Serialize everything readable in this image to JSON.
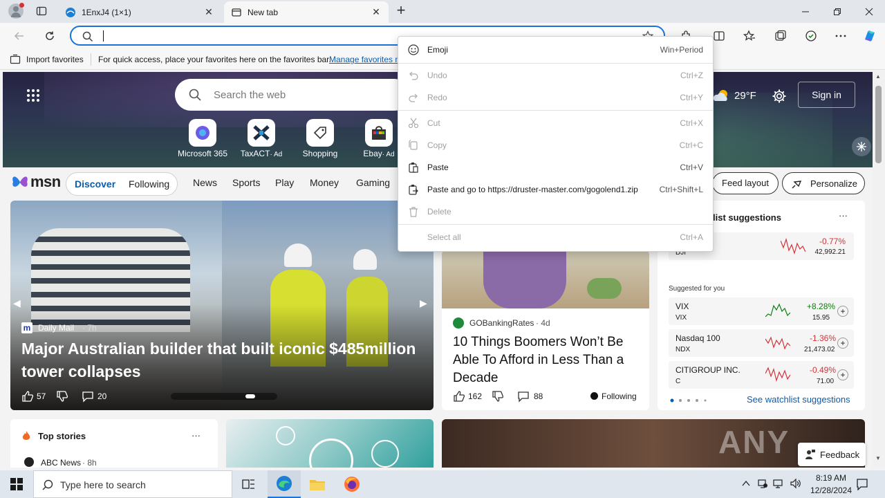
{
  "browser": {
    "tabs": [
      {
        "label": "1EnxJ4 (1×1)",
        "active": false
      },
      {
        "label": "New tab",
        "active": true
      }
    ],
    "new_tab_symbol": "+",
    "address_value": "",
    "favorites_bar": {
      "import_label": "Import favorites",
      "hint": "For quick access, place your favorites here on the favorites bar.",
      "manage_link": "Manage favorites n"
    }
  },
  "hero": {
    "search_placeholder": "Search the web",
    "weather": "29°F",
    "sign_in": "Sign in",
    "quick_links": [
      {
        "label": "Microsoft 365",
        "ad": ""
      },
      {
        "label": "TaxACT",
        "ad": "· Ad"
      },
      {
        "label": "Shopping",
        "ad": ""
      },
      {
        "label": "Ebay",
        "ad": "· Ad"
      }
    ]
  },
  "msn_nav": {
    "logo": "msn",
    "discover": "Discover",
    "following": "Following",
    "items": [
      "News",
      "Sports",
      "Play",
      "Money",
      "Gaming"
    ],
    "feed_layout": "Feed layout",
    "personalize": "Personalize"
  },
  "main_story": {
    "source": "Daily Mail",
    "age": "· 7h",
    "headline": "Major Australian builder that built iconic $485million tower collapses",
    "likes": "57",
    "comments": "20"
  },
  "second_story": {
    "source": "GOBankingRates",
    "age": "· 4d",
    "headline": "10 Things Boomers Won’t Be Able To Afford in Less Than a Decade",
    "likes": "162",
    "comments": "88",
    "following": "Following"
  },
  "watchlist": {
    "title": "list suggestions",
    "more": "···",
    "top": {
      "symbol": "DJI",
      "change": "-0.77%",
      "price": "42,992.21"
    },
    "suggested_label": "Suggested for you",
    "items": [
      {
        "name": "VIX",
        "symbol": "VIX",
        "change": "+8.28%",
        "price": "15.95",
        "up": true
      },
      {
        "name": "Nasdaq 100",
        "symbol": "NDX",
        "change": "-1.36%",
        "price": "21,473.02",
        "up": false
      },
      {
        "name": "CITIGROUP INC.",
        "symbol": "C",
        "change": "-0.49%",
        "price": "71.00",
        "up": false
      }
    ],
    "see_link": "See watchlist suggestions"
  },
  "top_stories": {
    "title": "Top stories",
    "more": "···",
    "first_source": "ABC News",
    "first_age": "· 8h"
  },
  "feedback": "Feedback",
  "watermark": "ANY RUN",
  "context_menu": {
    "items": [
      {
        "label": "Emoji",
        "shortcut": "Win+Period",
        "disabled": false
      },
      {
        "label": "Undo",
        "shortcut": "Ctrl+Z",
        "disabled": true
      },
      {
        "label": "Redo",
        "shortcut": "Ctrl+Y",
        "disabled": true
      },
      {
        "label": "Cut",
        "shortcut": "Ctrl+X",
        "disabled": true
      },
      {
        "label": "Copy",
        "shortcut": "Ctrl+C",
        "disabled": true
      },
      {
        "label": "Paste",
        "shortcut": "Ctrl+V",
        "disabled": false
      },
      {
        "label": "Paste and go to https://druster-master.com/gogolend1.zip",
        "shortcut": "Ctrl+Shift+L",
        "disabled": false
      },
      {
        "label": "Delete",
        "shortcut": "",
        "disabled": true
      },
      {
        "label": "Select all",
        "shortcut": "Ctrl+A",
        "disabled": true
      }
    ]
  },
  "taskbar": {
    "search_placeholder": "Type here to search",
    "time": "8:19 AM",
    "date": "12/28/2024"
  },
  "colors": {
    "accent": "#1a73d9",
    "down": "#d13438",
    "up": "#107c10"
  }
}
